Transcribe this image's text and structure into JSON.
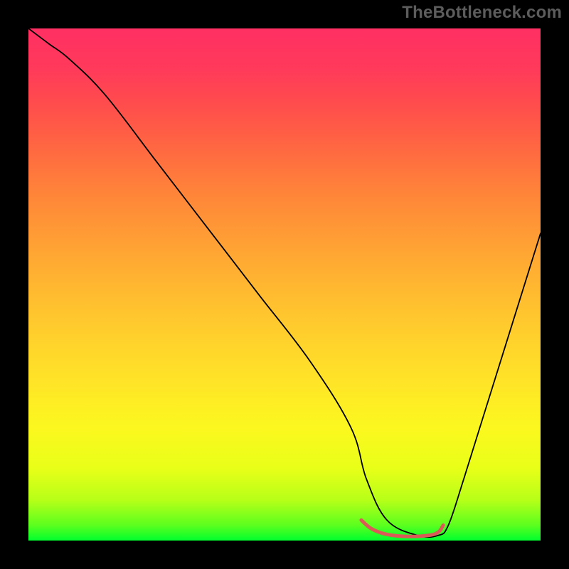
{
  "watermark": "TheBottleneck.com",
  "chart_data": {
    "type": "line",
    "title": "",
    "xlabel": "",
    "ylabel": "",
    "xlim": [
      0,
      100
    ],
    "ylim": [
      0,
      100
    ],
    "grid": false,
    "legend": false,
    "series": [
      {
        "name": "bottleneck-curve",
        "stroke": "#000000",
        "stroke_width": 1.8,
        "x": [
          0,
          4,
          8,
          15,
          25,
          35,
          45,
          55,
          63,
          66,
          70,
          76,
          80,
          82,
          85,
          90,
          95,
          100
        ],
        "values": [
          100,
          97,
          94,
          87,
          74,
          61,
          48,
          35,
          22,
          12,
          4,
          1,
          1,
          3,
          12,
          28,
          44,
          60
        ]
      },
      {
        "name": "recommended-range",
        "stroke": "#d95a57",
        "stroke_width": 5,
        "x": [
          65,
          67,
          70,
          74,
          78,
          80,
          81
        ],
        "values": [
          4,
          2.3,
          1.2,
          0.8,
          1.0,
          1.6,
          3
        ]
      }
    ],
    "gradient_stops": [
      {
        "pos": 0.0,
        "color": "#00ff2e"
      },
      {
        "pos": 0.03,
        "color": "#5cff1e"
      },
      {
        "pos": 0.08,
        "color": "#b8ff18"
      },
      {
        "pos": 0.14,
        "color": "#e8ff18"
      },
      {
        "pos": 0.22,
        "color": "#fcf81f"
      },
      {
        "pos": 0.32,
        "color": "#ffe228"
      },
      {
        "pos": 0.44,
        "color": "#ffc62e"
      },
      {
        "pos": 0.56,
        "color": "#ffa633"
      },
      {
        "pos": 0.68,
        "color": "#ff8439"
      },
      {
        "pos": 0.78,
        "color": "#ff6343"
      },
      {
        "pos": 0.86,
        "color": "#ff4a4e"
      },
      {
        "pos": 0.92,
        "color": "#ff3a5a"
      },
      {
        "pos": 1.0,
        "color": "#ff2f63"
      }
    ]
  }
}
